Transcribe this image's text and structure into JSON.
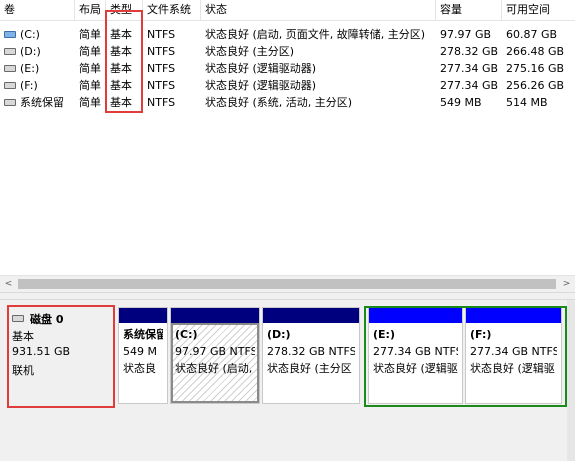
{
  "columns": [
    "卷",
    "布局",
    "类型",
    "文件系统",
    "状态",
    "容量",
    "可用空间"
  ],
  "volumes": [
    {
      "icon": "system-drive-icon",
      "name": "(C:)",
      "layout": "简单",
      "type": "基本",
      "fs": "NTFS",
      "status": "状态良好 (启动, 页面文件, 故障转储, 主分区)",
      "capacity": "97.97 GB",
      "free": "60.87 GB"
    },
    {
      "icon": "drive-icon",
      "name": "(D:)",
      "layout": "简单",
      "type": "基本",
      "fs": "NTFS",
      "status": "状态良好 (主分区)",
      "capacity": "278.32 GB",
      "free": "266.48 GB"
    },
    {
      "icon": "drive-icon",
      "name": "(E:)",
      "layout": "简单",
      "type": "基本",
      "fs": "NTFS",
      "status": "状态良好 (逻辑驱动器)",
      "capacity": "277.34 GB",
      "free": "275.16 GB"
    },
    {
      "icon": "drive-icon",
      "name": "(F:)",
      "layout": "简单",
      "type": "基本",
      "fs": "NTFS",
      "status": "状态良好 (逻辑驱动器)",
      "capacity": "277.34 GB",
      "free": "256.26 GB"
    },
    {
      "icon": "drive-icon",
      "name": "系统保留",
      "layout": "简单",
      "type": "基本",
      "fs": "NTFS",
      "status": "状态良好 (系统, 活动, 主分区)",
      "capacity": "549 MB",
      "free": "514 MB"
    }
  ],
  "scrollbar": {
    "left_arrow": "<",
    "right_arrow": ">"
  },
  "disk": {
    "name": "磁盘 0",
    "type": "基本",
    "size": "931.51 GB",
    "status": "联机"
  },
  "partitions": [
    {
      "title": "系统保留",
      "size": "549 M",
      "status": "状态良",
      "bar_color": "#00007f"
    },
    {
      "title": "(C:)",
      "size": "97.97 GB NTFS",
      "status": "状态良好 (启动,",
      "bar_color": "#00007f"
    },
    {
      "title": "(D:)",
      "size": "278.32 GB NTFS",
      "status": "状态良好 (主分区",
      "bar_color": "#00007f"
    },
    {
      "title": "(E:)",
      "size": "277.34 GB NTFS",
      "status": "状态良好 (逻辑驱",
      "bar_color": "#0000ff"
    },
    {
      "title": "(F:)",
      "size": "277.34 GB NTFS",
      "status": "状态良好 (逻辑驱",
      "bar_color": "#0000ff"
    }
  ],
  "colors": {
    "highlight_red": "#e03c3c",
    "highlight_green": "#1a8a1a",
    "primary_bar": "#00007f",
    "logical_bar": "#0000ff"
  }
}
